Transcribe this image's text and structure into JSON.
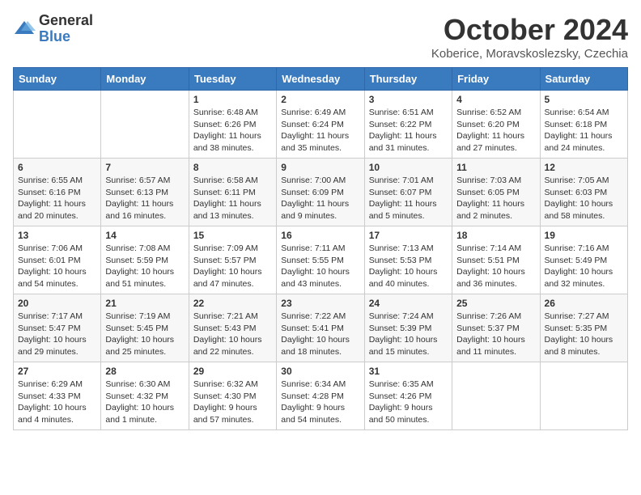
{
  "logo": {
    "general": "General",
    "blue": "Blue"
  },
  "title": "October 2024",
  "subtitle": "Koberice, Moravskoslezsky, Czechia",
  "headers": [
    "Sunday",
    "Monday",
    "Tuesday",
    "Wednesday",
    "Thursday",
    "Friday",
    "Saturday"
  ],
  "weeks": [
    [
      {
        "day": "",
        "info": ""
      },
      {
        "day": "",
        "info": ""
      },
      {
        "day": "1",
        "info": "Sunrise: 6:48 AM\nSunset: 6:26 PM\nDaylight: 11 hours and 38 minutes."
      },
      {
        "day": "2",
        "info": "Sunrise: 6:49 AM\nSunset: 6:24 PM\nDaylight: 11 hours and 35 minutes."
      },
      {
        "day": "3",
        "info": "Sunrise: 6:51 AM\nSunset: 6:22 PM\nDaylight: 11 hours and 31 minutes."
      },
      {
        "day": "4",
        "info": "Sunrise: 6:52 AM\nSunset: 6:20 PM\nDaylight: 11 hours and 27 minutes."
      },
      {
        "day": "5",
        "info": "Sunrise: 6:54 AM\nSunset: 6:18 PM\nDaylight: 11 hours and 24 minutes."
      }
    ],
    [
      {
        "day": "6",
        "info": "Sunrise: 6:55 AM\nSunset: 6:16 PM\nDaylight: 11 hours and 20 minutes."
      },
      {
        "day": "7",
        "info": "Sunrise: 6:57 AM\nSunset: 6:13 PM\nDaylight: 11 hours and 16 minutes."
      },
      {
        "day": "8",
        "info": "Sunrise: 6:58 AM\nSunset: 6:11 PM\nDaylight: 11 hours and 13 minutes."
      },
      {
        "day": "9",
        "info": "Sunrise: 7:00 AM\nSunset: 6:09 PM\nDaylight: 11 hours and 9 minutes."
      },
      {
        "day": "10",
        "info": "Sunrise: 7:01 AM\nSunset: 6:07 PM\nDaylight: 11 hours and 5 minutes."
      },
      {
        "day": "11",
        "info": "Sunrise: 7:03 AM\nSunset: 6:05 PM\nDaylight: 11 hours and 2 minutes."
      },
      {
        "day": "12",
        "info": "Sunrise: 7:05 AM\nSunset: 6:03 PM\nDaylight: 10 hours and 58 minutes."
      }
    ],
    [
      {
        "day": "13",
        "info": "Sunrise: 7:06 AM\nSunset: 6:01 PM\nDaylight: 10 hours and 54 minutes."
      },
      {
        "day": "14",
        "info": "Sunrise: 7:08 AM\nSunset: 5:59 PM\nDaylight: 10 hours and 51 minutes."
      },
      {
        "day": "15",
        "info": "Sunrise: 7:09 AM\nSunset: 5:57 PM\nDaylight: 10 hours and 47 minutes."
      },
      {
        "day": "16",
        "info": "Sunrise: 7:11 AM\nSunset: 5:55 PM\nDaylight: 10 hours and 43 minutes."
      },
      {
        "day": "17",
        "info": "Sunrise: 7:13 AM\nSunset: 5:53 PM\nDaylight: 10 hours and 40 minutes."
      },
      {
        "day": "18",
        "info": "Sunrise: 7:14 AM\nSunset: 5:51 PM\nDaylight: 10 hours and 36 minutes."
      },
      {
        "day": "19",
        "info": "Sunrise: 7:16 AM\nSunset: 5:49 PM\nDaylight: 10 hours and 32 minutes."
      }
    ],
    [
      {
        "day": "20",
        "info": "Sunrise: 7:17 AM\nSunset: 5:47 PM\nDaylight: 10 hours and 29 minutes."
      },
      {
        "day": "21",
        "info": "Sunrise: 7:19 AM\nSunset: 5:45 PM\nDaylight: 10 hours and 25 minutes."
      },
      {
        "day": "22",
        "info": "Sunrise: 7:21 AM\nSunset: 5:43 PM\nDaylight: 10 hours and 22 minutes."
      },
      {
        "day": "23",
        "info": "Sunrise: 7:22 AM\nSunset: 5:41 PM\nDaylight: 10 hours and 18 minutes."
      },
      {
        "day": "24",
        "info": "Sunrise: 7:24 AM\nSunset: 5:39 PM\nDaylight: 10 hours and 15 minutes."
      },
      {
        "day": "25",
        "info": "Sunrise: 7:26 AM\nSunset: 5:37 PM\nDaylight: 10 hours and 11 minutes."
      },
      {
        "day": "26",
        "info": "Sunrise: 7:27 AM\nSunset: 5:35 PM\nDaylight: 10 hours and 8 minutes."
      }
    ],
    [
      {
        "day": "27",
        "info": "Sunrise: 6:29 AM\nSunset: 4:33 PM\nDaylight: 10 hours and 4 minutes."
      },
      {
        "day": "28",
        "info": "Sunrise: 6:30 AM\nSunset: 4:32 PM\nDaylight: 10 hours and 1 minute."
      },
      {
        "day": "29",
        "info": "Sunrise: 6:32 AM\nSunset: 4:30 PM\nDaylight: 9 hours and 57 minutes."
      },
      {
        "day": "30",
        "info": "Sunrise: 6:34 AM\nSunset: 4:28 PM\nDaylight: 9 hours and 54 minutes."
      },
      {
        "day": "31",
        "info": "Sunrise: 6:35 AM\nSunset: 4:26 PM\nDaylight: 9 hours and 50 minutes."
      },
      {
        "day": "",
        "info": ""
      },
      {
        "day": "",
        "info": ""
      }
    ]
  ]
}
